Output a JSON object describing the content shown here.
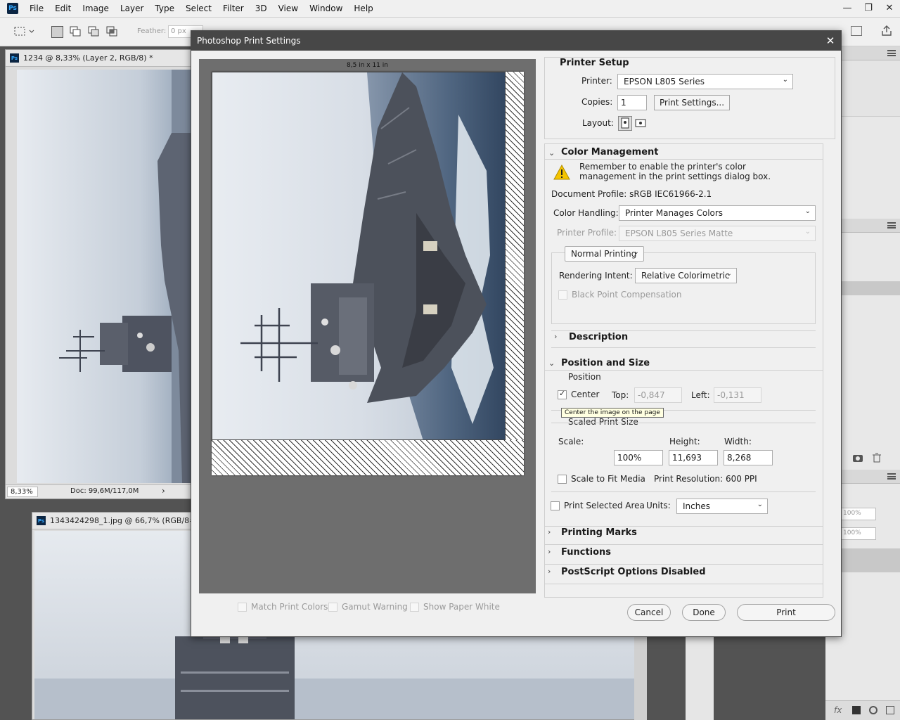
{
  "app": {
    "logo": "Ps",
    "menu": [
      "File",
      "Edit",
      "Image",
      "Layer",
      "Type",
      "Select",
      "Filter",
      "3D",
      "View",
      "Window",
      "Help"
    ],
    "window_controls": [
      "—",
      "❐",
      "✕"
    ]
  },
  "options_bar": {
    "feather_label": "Feather:",
    "feather_value": "0 px"
  },
  "documents": [
    {
      "title": "1234 @ 8,33% (Layer 2, RGB/8) *",
      "zoom": "8,33%",
      "doc_size": "Doc: 99,6M/117,0M"
    },
    {
      "title": "1343424298_1.jpg @ 66,7% (RGB/8#)"
    }
  ],
  "panels": {
    "opacity_1": "100%",
    "opacity_2": "100%"
  },
  "dialog": {
    "title": "Photoshop Print Settings",
    "close_glyph": "✕",
    "paper_size": "8,5 in x 11 in",
    "printer_setup": {
      "heading": "Printer Setup",
      "printer_label": "Printer:",
      "printer_value": "EPSON L805 Series",
      "copies_label": "Copies:",
      "copies_value": "1",
      "print_settings_button": "Print Settings...",
      "layout_label": "Layout:"
    },
    "color_management": {
      "heading": "Color Management",
      "warning": "Remember to enable the printer's color management in the print settings dialog box.",
      "document_profile": "Document Profile: sRGB IEC61966-2.1",
      "color_handling_label": "Color Handling:",
      "color_handling_value": "Printer Manages Colors",
      "printer_profile_label": "Printer Profile:",
      "printer_profile_value": "EPSON L805 Series Matte",
      "normal_printing": "Normal Printing",
      "rendering_intent_label": "Rendering Intent:",
      "rendering_intent_value": "Relative Colorimetric",
      "black_point": "Black Point Compensation"
    },
    "description": {
      "heading": "Description"
    },
    "position_size": {
      "heading": "Position and Size",
      "position_label": "Position",
      "center_label": "Center",
      "top_label": "Top:",
      "top_value": "-0,847",
      "left_label": "Left:",
      "left_value": "-0,131",
      "tooltip": "Center the image on the page",
      "scaled_print_size": "Scaled Print Size",
      "scale_label": "Scale:",
      "scale_value": "100%",
      "height_label": "Height:",
      "height_value": "11,693",
      "width_label": "Width:",
      "width_value": "8,268",
      "scale_to_fit": "Scale to Fit Media",
      "print_resolution": "Print Resolution: 600 PPI",
      "print_selected_area": "Print Selected Area",
      "units_label": "Units:",
      "units_value": "Inches"
    },
    "printing_marks": {
      "heading": "Printing Marks"
    },
    "functions": {
      "heading": "Functions"
    },
    "postscript": {
      "heading": "PostScript Options Disabled"
    },
    "preview_options": {
      "match_print_colors": "Match Print Colors",
      "gamut_warning": "Gamut Warning",
      "show_paper_white": "Show Paper White"
    },
    "buttons": {
      "cancel": "Cancel",
      "done": "Done",
      "print": "Print"
    }
  },
  "colors": {
    "workspace_bg": "#535353",
    "dialog_title_bg": "#474747",
    "preview_bg": "#6e6e6e",
    "tooltip_bg": "#ffffe1",
    "warning_yellow": "#f5c400"
  },
  "icons": {
    "warning": "warning-triangle-icon",
    "dropdown": "chevron-down-icon",
    "expanded": "chevron-down-icon",
    "collapsed": "chevron-right-icon"
  }
}
